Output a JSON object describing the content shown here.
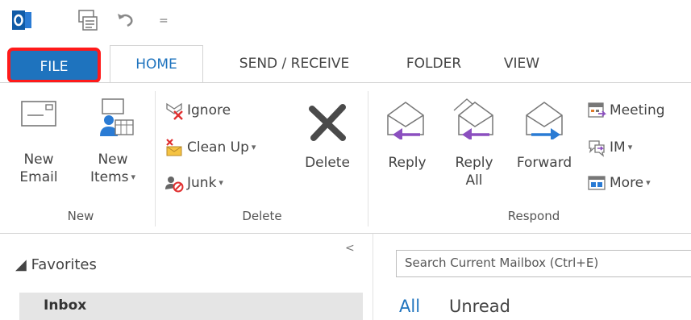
{
  "qat": {
    "app_icon": "outlook-app-icon",
    "send_receive_icon": "send-receive-all-icon",
    "undo_icon": "undo-icon",
    "customize_glyph": "="
  },
  "tabs": [
    {
      "label": "FILE"
    },
    {
      "label": "HOME"
    },
    {
      "label": "SEND / RECEIVE"
    },
    {
      "label": "FOLDER"
    },
    {
      "label": "VIEW"
    }
  ],
  "ribbon": {
    "new_group": {
      "label": "New",
      "new_email": {
        "line1": "New",
        "line2": "Email"
      },
      "new_items": {
        "line1": "New",
        "line2": "Items"
      }
    },
    "delete_group": {
      "label": "Delete",
      "ignore": "Ignore",
      "clean_up": "Clean Up",
      "junk": "Junk",
      "delete": "Delete"
    },
    "respond_group": {
      "label": "Respond",
      "reply": "Reply",
      "reply_all": {
        "line1": "Reply",
        "line2": "All"
      },
      "forward": "Forward",
      "meeting": "Meeting",
      "im": "IM",
      "more": "More"
    },
    "caret": "▾"
  },
  "nav": {
    "collapse_glyph": "<",
    "favorites": "◢ Favorites",
    "inbox": "Inbox"
  },
  "mail": {
    "search_placeholder": "Search Current Mailbox (Ctrl+E)",
    "filter_all": "All",
    "filter_unread": "Unread"
  },
  "colors": {
    "accent": "#1e73be",
    "file_highlight": "#ff1a1a",
    "forward_arrow": "#2a7bd4",
    "reply_arrow": "#8b4fbf"
  }
}
